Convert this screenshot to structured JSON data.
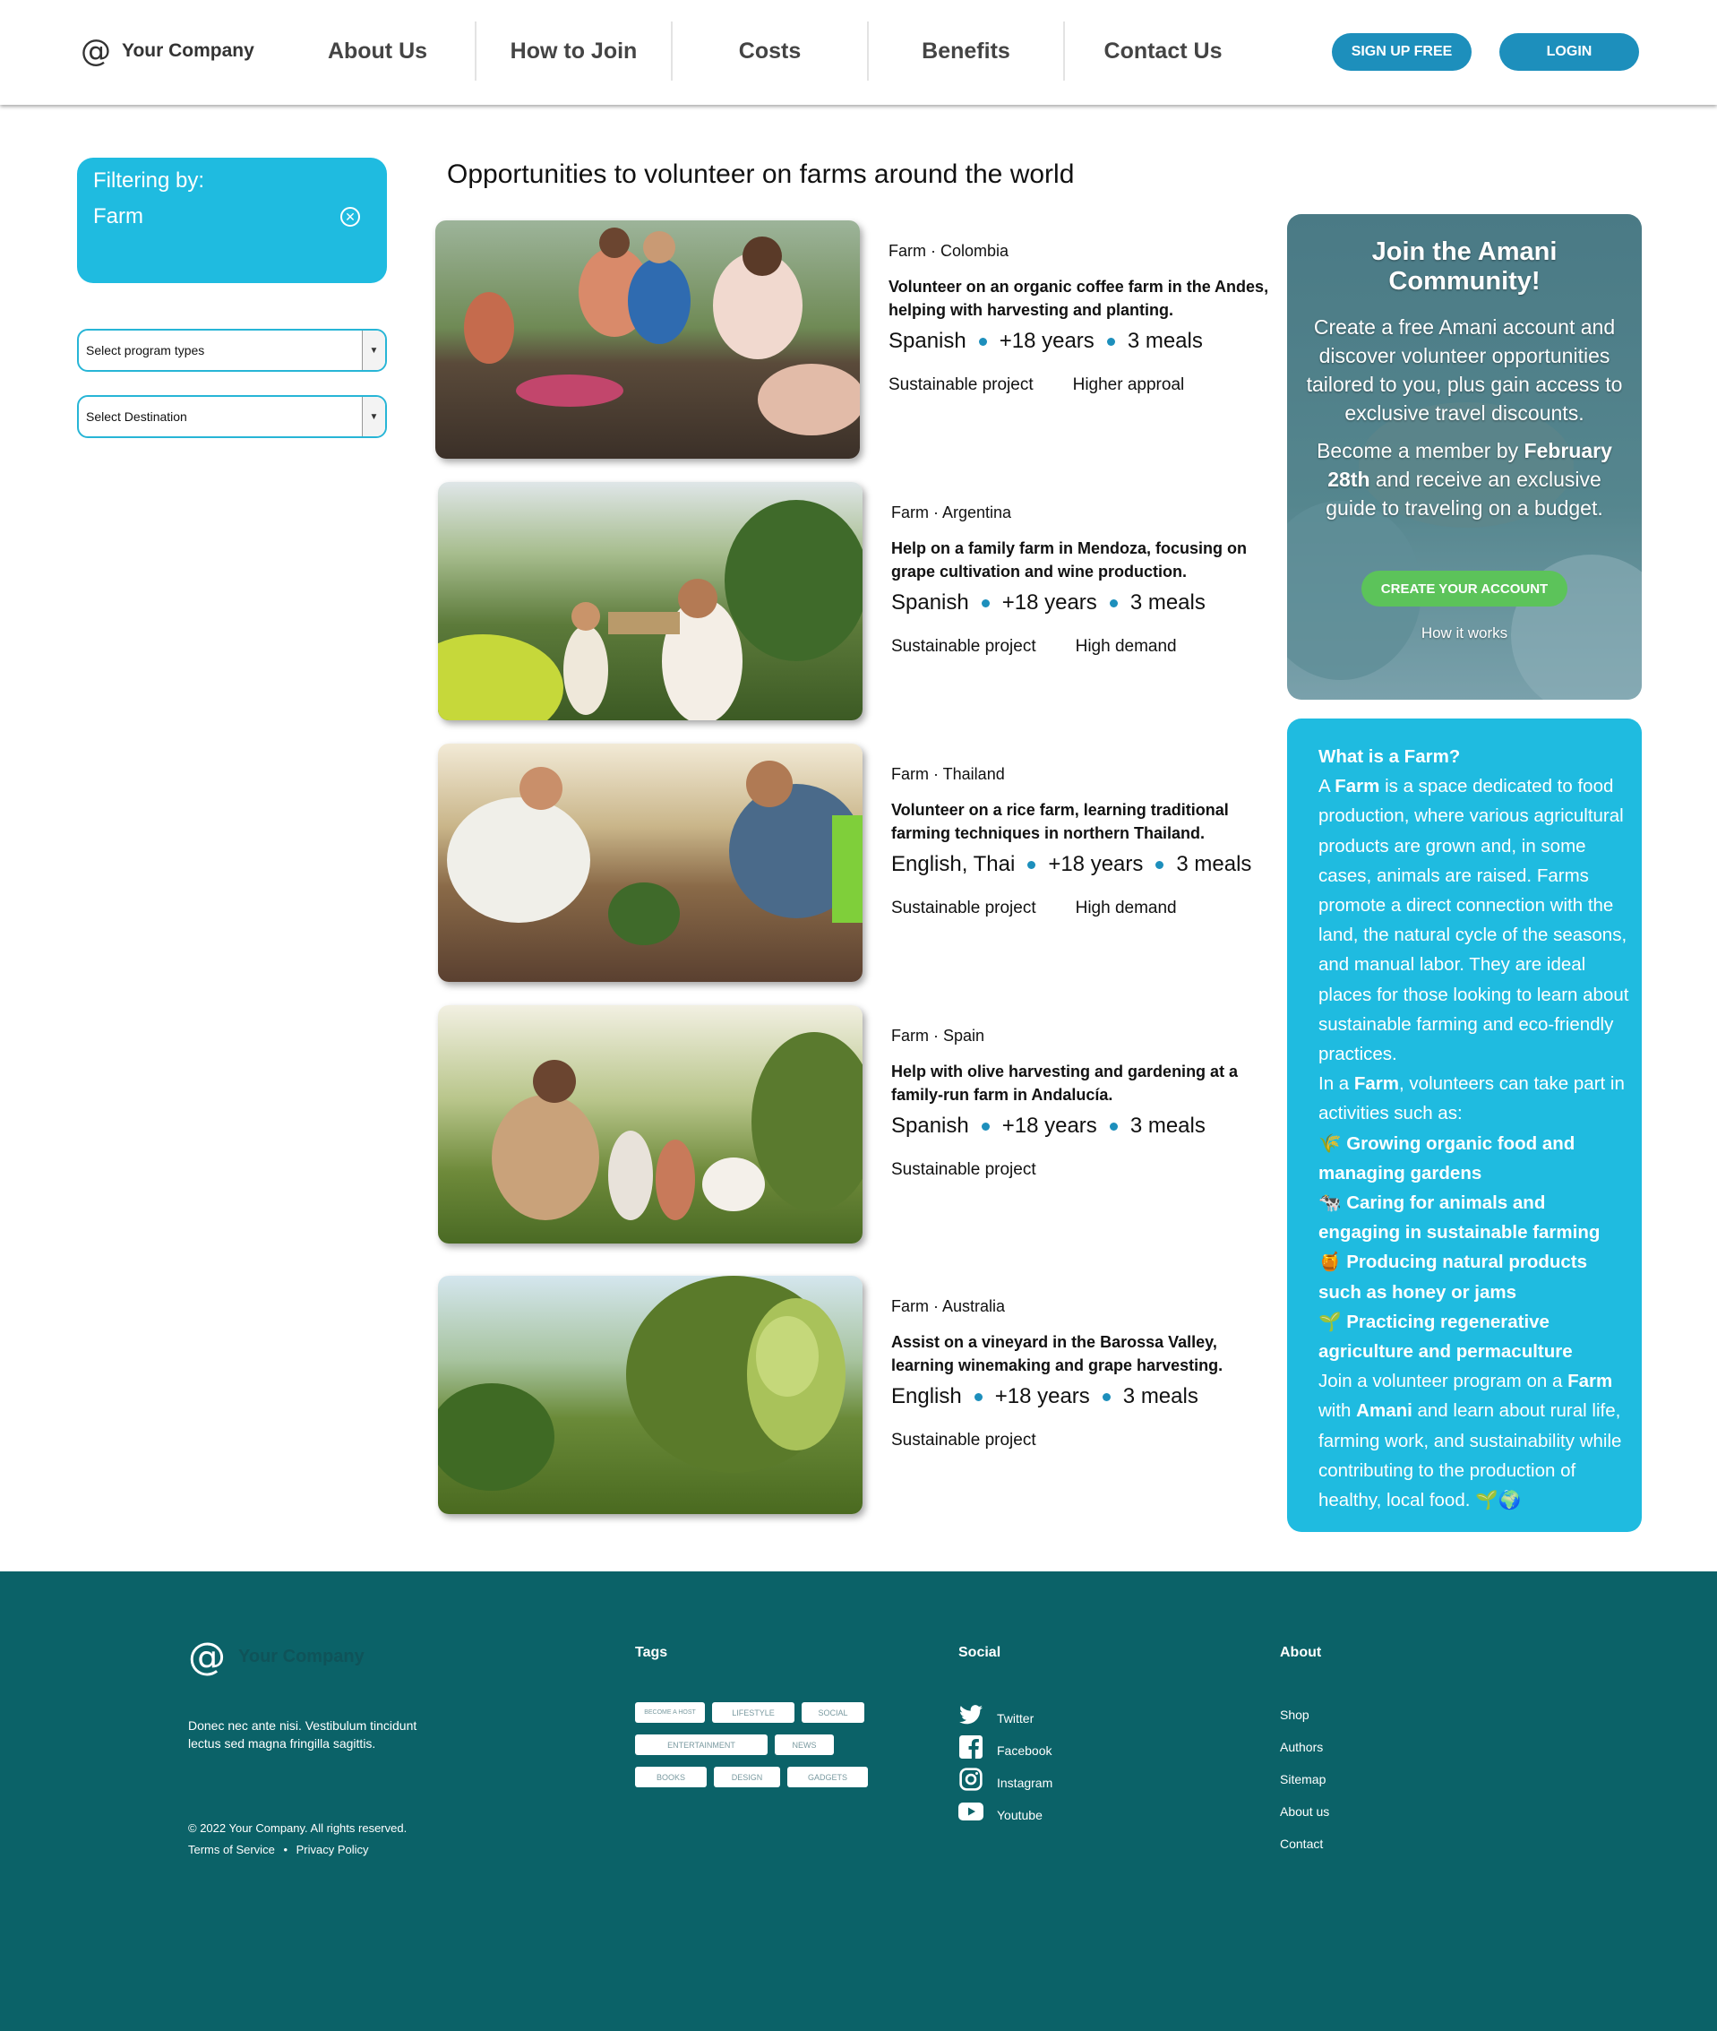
{
  "header": {
    "logo_text": "Your Company",
    "nav": [
      "About Us",
      "How to Join",
      "Costs",
      "Benefits",
      "Contact Us"
    ],
    "signup_label": "SIGN UP FREE",
    "login_label": "LOGIN"
  },
  "filter": {
    "title": "Filtering by:",
    "value": "Farm",
    "program_select": "Select program types",
    "destination_select": "Select Destination"
  },
  "page_title": "Opportunities to volunteer on farms around the world",
  "cards": [
    {
      "location": "Farm · Colombia",
      "description": "Volunteer on an organic coffee farm in the Andes, helping with harvesting and planting.",
      "language": "Spanish",
      "age": "+18 years",
      "meals": "3 meals",
      "tags": [
        "Sustainable project",
        "Higher approal"
      ]
    },
    {
      "location": "Farm · Argentina",
      "description": "Help on a family farm in Mendoza, focusing on grape cultivation and wine production.",
      "language": "Spanish",
      "age": "+18 years",
      "meals": "3 meals",
      "tags": [
        "Sustainable project",
        "High demand"
      ]
    },
    {
      "location": "Farm · Thailand",
      "description": "Volunteer on a rice farm, learning traditional farming techniques in northern Thailand.",
      "language": "English, Thai",
      "age": "+18 years",
      "meals": "3 meals",
      "tags": [
        "Sustainable project",
        "High demand"
      ]
    },
    {
      "location": "Farm · Spain",
      "description": "Help with olive harvesting and gardening at a family-run farm in Andalucía.",
      "language": "Spanish",
      "age": "+18 years",
      "meals": "3 meals",
      "tags": [
        "Sustainable project"
      ]
    },
    {
      "location": "Farm · Australia",
      "description": "Assist on a vineyard in the Barossa Valley, learning winemaking and grape harvesting.",
      "language": "English",
      "age": "+18 years",
      "meals": "3 meals",
      "tags": [
        "Sustainable project"
      ]
    }
  ],
  "promo": {
    "title": "Join the Amani Community!",
    "text": "Create a free Amani account and discover volunteer opportunities tailored to you, plus gain access to exclusive travel discounts.",
    "text2_pre": "Become a member by ",
    "text2_bold": "February 28th",
    "text2_post": " and receive an exclusive guide to traveling on a budget.",
    "button": "CREATE YOUR ACCOUNT",
    "link": "How it works"
  },
  "info": {
    "title": "What is a Farm?",
    "p1_a": "A ",
    "p1_b": "Farm",
    "p1_c": " is a space dedicated to food production, where various agricultural products are grown and, in some cases, animals are raised. Farms promote a direct connection with the land, the natural cycle of the seasons, and manual labor. They are ideal places for those looking to learn about sustainable farming and eco-friendly practices.",
    "p2_a": "In a ",
    "p2_b": "Farm",
    "p2_c": ", volunteers can take part in activities such as:",
    "list": [
      "🌾 Growing organic food and managing gardens",
      "🐄 Caring for animals and engaging in sustainable farming",
      "🍯 Producing natural products such as honey or jams",
      "🌱 Practicing regenerative agriculture and permaculture"
    ],
    "p3_a": "Join a volunteer program on a ",
    "p3_b": "Farm",
    "p3_c": " with ",
    "p3_d": "Amani",
    "p3_e": " and learn about rural life, farming work, and sustainability while contributing to the production of healthy, local food. 🌱🌍"
  },
  "footer": {
    "logo_text": "Your Company",
    "description": "Donec nec ante nisi. Vestibulum tincidunt lectus sed magna fringilla sagittis.",
    "copyright": "© 2022 Your Company.  All rights reserved.",
    "terms": "Terms of Service",
    "sep": "•",
    "privacy": "Privacy Policy",
    "tags_title": "Tags",
    "tags": [
      "BECOME A HOST",
      "LIFESTYLE",
      "SOCIAL",
      "ENTERTAINMENT",
      "NEWS",
      "BOOKS",
      "DESIGN",
      "GADGETS"
    ],
    "social_title": "Social",
    "social": [
      "Twitter",
      "Facebook",
      "Instagram",
      "Youtube"
    ],
    "about_title": "About",
    "about": [
      "Shop",
      "Authors",
      "Sitemap",
      "About us",
      "Contact"
    ]
  },
  "colors": {
    "accent": "#1fbbe0",
    "button": "#1d8fbc",
    "green": "#5cc35a",
    "footer": "#0b6268"
  }
}
